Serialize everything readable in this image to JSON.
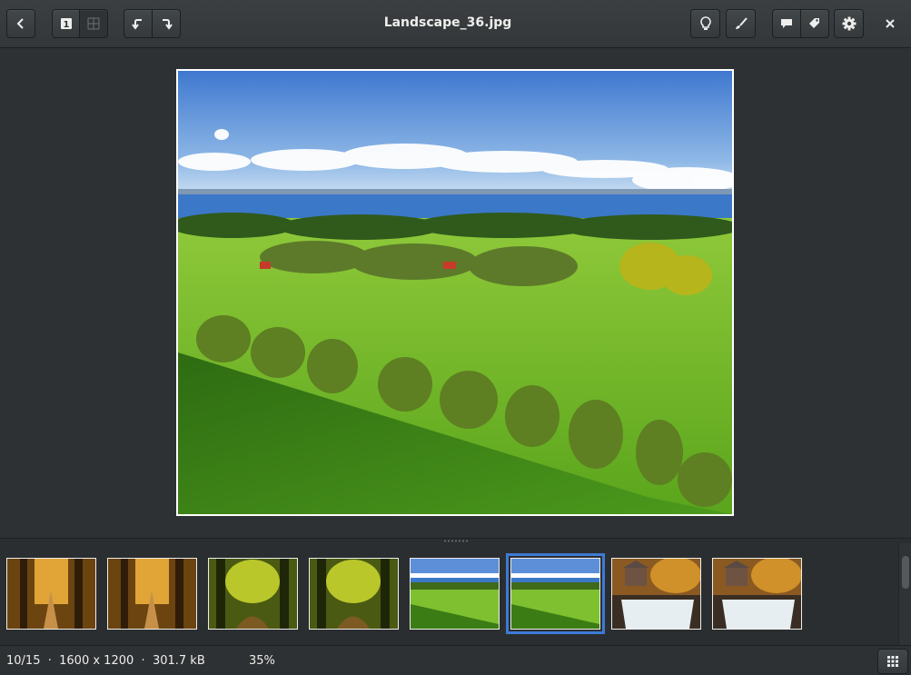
{
  "window": {
    "title": "Landscape_36.jpg"
  },
  "toolbar": {
    "back": "back-icon",
    "view_single": "single-view-icon",
    "view_grid": "grid-view-icon",
    "rotate_left": "rotate-left-icon",
    "rotate_right": "rotate-right-icon",
    "enhance": "lightbulb-icon",
    "edit": "brush-icon",
    "comment": "comment-icon",
    "tags": "tag-icon",
    "settings": "gear-icon",
    "close": "close-icon"
  },
  "thumbnails": [
    {
      "kind": "autumn-path"
    },
    {
      "kind": "autumn-path"
    },
    {
      "kind": "forest-stream"
    },
    {
      "kind": "forest-stream"
    },
    {
      "kind": "landscape"
    },
    {
      "kind": "landscape",
      "selected": true
    },
    {
      "kind": "waterfall"
    },
    {
      "kind": "waterfall"
    }
  ],
  "status": {
    "position": "10/15",
    "separator": "·",
    "dimensions": "1600 x 1200",
    "filesize": "301.7 kB",
    "zoom": "35%"
  },
  "colors": {
    "accent": "#3d7ad6",
    "background": "#2e3133"
  }
}
